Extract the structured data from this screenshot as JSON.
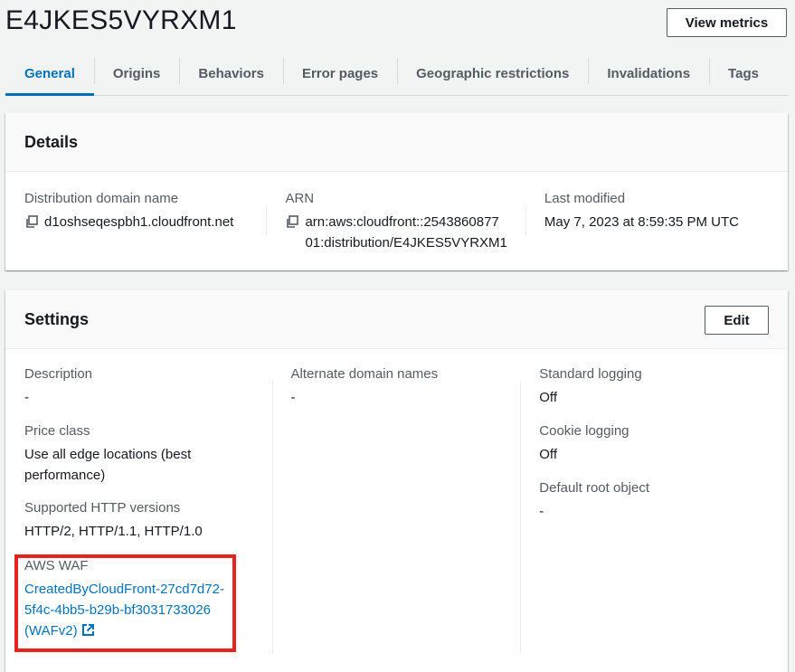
{
  "header": {
    "title": "E4JKES5VYRXM1",
    "view_metrics_label": "View metrics"
  },
  "tabs": [
    {
      "label": "General",
      "active": true
    },
    {
      "label": "Origins",
      "active": false
    },
    {
      "label": "Behaviors",
      "active": false
    },
    {
      "label": "Error pages",
      "active": false
    },
    {
      "label": "Geographic restrictions",
      "active": false
    },
    {
      "label": "Invalidations",
      "active": false
    },
    {
      "label": "Tags",
      "active": false
    }
  ],
  "details": {
    "title": "Details",
    "domain_name": {
      "label": "Distribution domain name",
      "value": "d1oshseqespbh1.cloudfront.net"
    },
    "arn": {
      "label": "ARN",
      "value_line1": "arn:aws:cloudfront::2543860877",
      "value_line2": "01:distribution/E4JKES5VYRXM1"
    },
    "last_modified": {
      "label": "Last modified",
      "value": "May 7, 2023 at 8:59:35 PM UTC"
    }
  },
  "settings": {
    "title": "Settings",
    "edit_label": "Edit",
    "description": {
      "label": "Description",
      "value": "-"
    },
    "price_class": {
      "label": "Price class",
      "value_line1": "Use all edge locations (best",
      "value_line2": "performance)"
    },
    "http_versions": {
      "label": "Supported HTTP versions",
      "value": "HTTP/2, HTTP/1.1, HTTP/1.0"
    },
    "waf": {
      "label": "AWS WAF",
      "link_line1": "CreatedByCloudFront-27cd7d72-",
      "link_line2": "5f4c-4bb5-b29b-bf3031733026",
      "link_line3": "(WAFv2)"
    },
    "alternate_domains": {
      "label": "Alternate domain names",
      "value": "-"
    },
    "standard_logging": {
      "label": "Standard logging",
      "value": "Off"
    },
    "cookie_logging": {
      "label": "Cookie logging",
      "value": "Off"
    },
    "default_root": {
      "label": "Default root object",
      "value": "-"
    }
  },
  "colors": {
    "accent": "#0073bb",
    "highlight": "#e8231f",
    "text": "#16191f",
    "muted": "#545b64"
  }
}
